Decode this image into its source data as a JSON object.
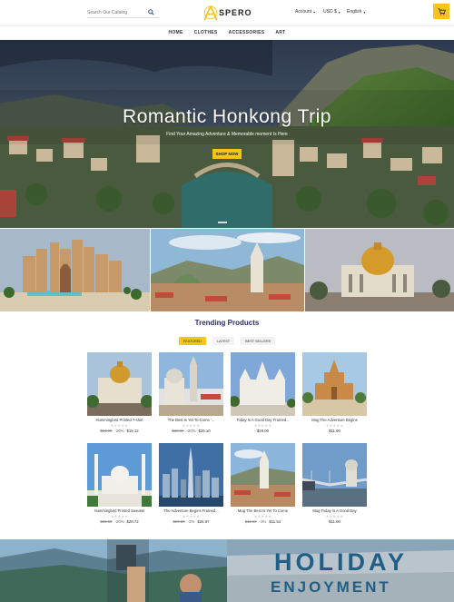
{
  "header": {
    "search_placeholder": "Search Our Catalog",
    "logo_text": "SPERO",
    "account_label": "Account",
    "currency_label": "USD $",
    "language_label": "English"
  },
  "nav": [
    "HOME",
    "CLOTHES",
    "ACCESSORIES",
    "ART"
  ],
  "hero": {
    "title": "Romantic Honkong Trip",
    "subtitle": "Find Your Amazing Adventure & Memorable moment Is Here",
    "button_label": "SHOP NOW"
  },
  "trending": {
    "title": "Trending Products",
    "tabs": [
      "FEATURED",
      "LATEST",
      "BEST SELLERS"
    ],
    "active_tab": 0
  },
  "products": [
    {
      "name": "Hummingbird Printed T-shirt",
      "old_price": "$23.90",
      "discount": "-20%",
      "price": "$19.12",
      "rating": 0
    },
    {
      "name": "The Best Is Yet To Come '...",
      "old_price": "$33.00",
      "discount": "-20%",
      "price": "$26.10",
      "rating": 0
    },
    {
      "name": "Today Is A Good Day Framed...",
      "old_price": "",
      "discount": "",
      "price": "$29.00",
      "rating": 0
    },
    {
      "name": "Mug The Adventure Begins",
      "old_price": "",
      "discount": "",
      "price": "$11.90",
      "rating": 0
    },
    {
      "name": "Hummingbird Printed Sweater",
      "old_price": "$35.90",
      "discount": "-20%",
      "price": "$28.72",
      "rating": 0
    },
    {
      "name": "The Adventure Begins Framed...",
      "old_price": "$29.00",
      "discount": "-2%",
      "price": "$28.97",
      "rating": 0
    },
    {
      "name": "Mug The Best Is Yet To Come",
      "old_price": "$11.90",
      "discount": "-3%",
      "price": "$11.54",
      "rating": 0
    },
    {
      "name": "Mug Today Is A Good Day",
      "old_price": "",
      "discount": "",
      "price": "$11.90",
      "rating": 0
    }
  ],
  "bottom_banner": {
    "line1": "HOLIDAY",
    "line2": "ENJOYMENT"
  },
  "colors": {
    "accent": "#f5c518",
    "title": "#2b2b6a",
    "banner_text": "#1f5f86"
  }
}
